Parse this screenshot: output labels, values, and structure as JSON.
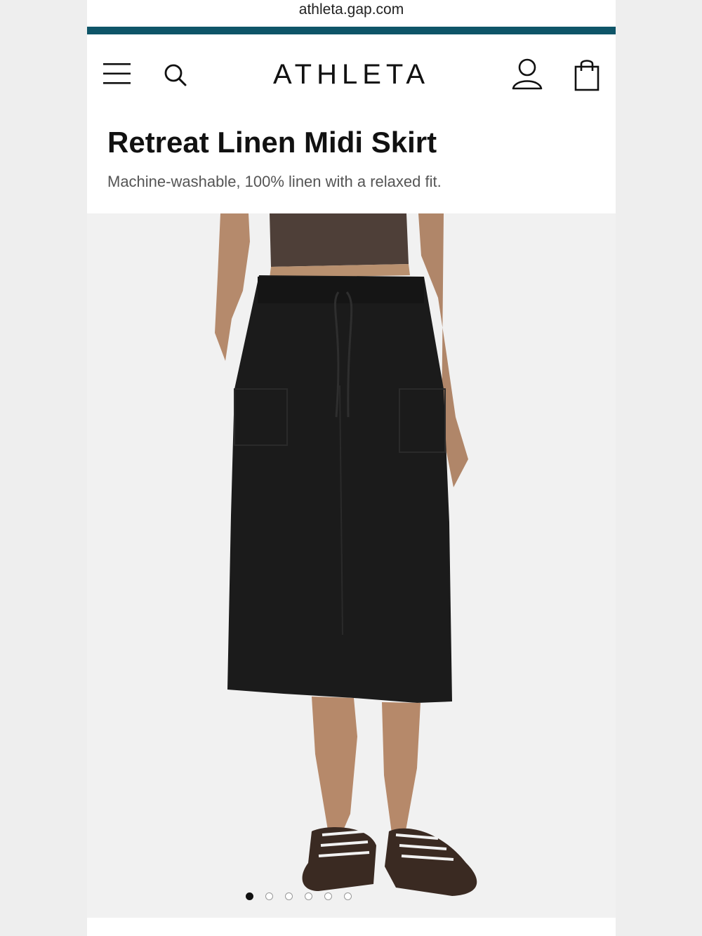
{
  "browser": {
    "url": "athleta.gap.com"
  },
  "header": {
    "brand": "ATHLETA",
    "icons": [
      "menu-icon",
      "search-icon",
      "account-icon",
      "shopping-bag-icon"
    ]
  },
  "product": {
    "title": "Retreat Linen Midi Skirt",
    "subtitle": "Machine-washable, 100% linen with a relaxed fit."
  },
  "gallery": {
    "image_count": 6,
    "active_index": 0
  },
  "colors": {
    "accent": "#0e5568",
    "skirt": "#1b1b1b",
    "top": "#4e3f38",
    "shoes": "#3a2a22",
    "background": "#f1f1f1"
  }
}
